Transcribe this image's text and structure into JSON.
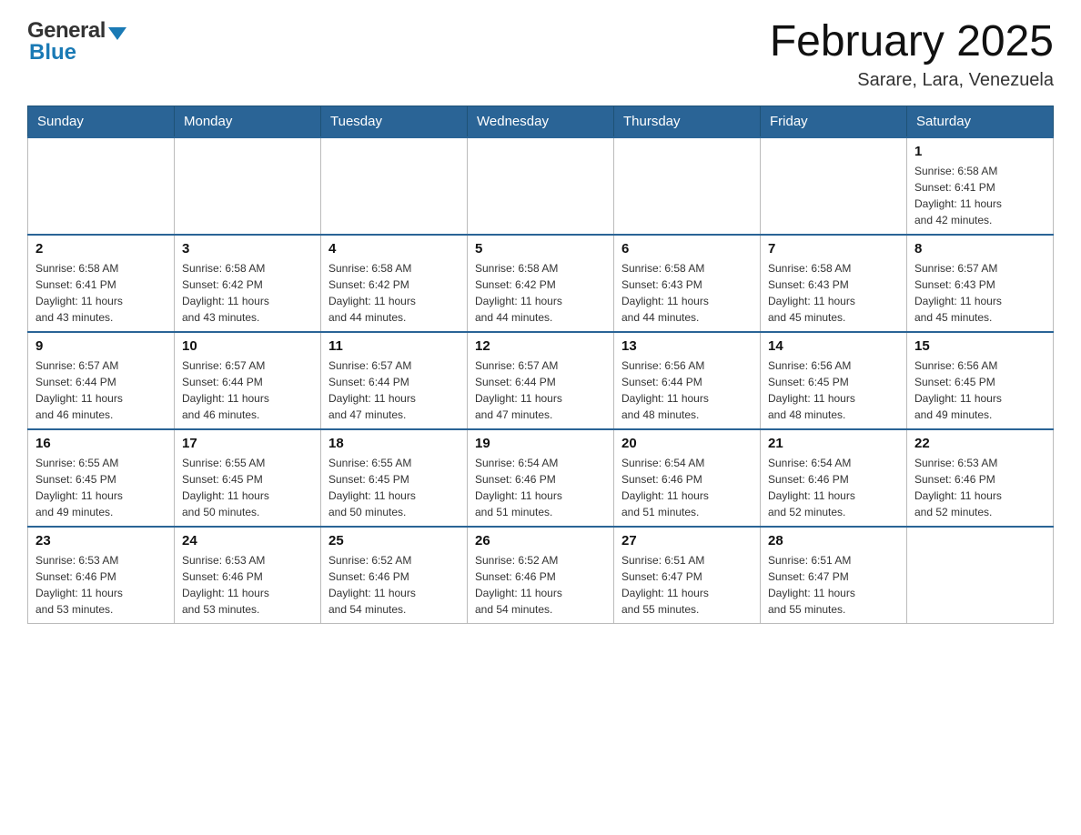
{
  "header": {
    "logo": {
      "general": "General",
      "blue": "Blue"
    },
    "title": "February 2025",
    "location": "Sarare, Lara, Venezuela"
  },
  "calendar": {
    "days_of_week": [
      "Sunday",
      "Monday",
      "Tuesday",
      "Wednesday",
      "Thursday",
      "Friday",
      "Saturday"
    ],
    "weeks": [
      [
        {
          "day": "",
          "info": ""
        },
        {
          "day": "",
          "info": ""
        },
        {
          "day": "",
          "info": ""
        },
        {
          "day": "",
          "info": ""
        },
        {
          "day": "",
          "info": ""
        },
        {
          "day": "",
          "info": ""
        },
        {
          "day": "1",
          "info": "Sunrise: 6:58 AM\nSunset: 6:41 PM\nDaylight: 11 hours\nand 42 minutes."
        }
      ],
      [
        {
          "day": "2",
          "info": "Sunrise: 6:58 AM\nSunset: 6:41 PM\nDaylight: 11 hours\nand 43 minutes."
        },
        {
          "day": "3",
          "info": "Sunrise: 6:58 AM\nSunset: 6:42 PM\nDaylight: 11 hours\nand 43 minutes."
        },
        {
          "day": "4",
          "info": "Sunrise: 6:58 AM\nSunset: 6:42 PM\nDaylight: 11 hours\nand 44 minutes."
        },
        {
          "day": "5",
          "info": "Sunrise: 6:58 AM\nSunset: 6:42 PM\nDaylight: 11 hours\nand 44 minutes."
        },
        {
          "day": "6",
          "info": "Sunrise: 6:58 AM\nSunset: 6:43 PM\nDaylight: 11 hours\nand 44 minutes."
        },
        {
          "day": "7",
          "info": "Sunrise: 6:58 AM\nSunset: 6:43 PM\nDaylight: 11 hours\nand 45 minutes."
        },
        {
          "day": "8",
          "info": "Sunrise: 6:57 AM\nSunset: 6:43 PM\nDaylight: 11 hours\nand 45 minutes."
        }
      ],
      [
        {
          "day": "9",
          "info": "Sunrise: 6:57 AM\nSunset: 6:44 PM\nDaylight: 11 hours\nand 46 minutes."
        },
        {
          "day": "10",
          "info": "Sunrise: 6:57 AM\nSunset: 6:44 PM\nDaylight: 11 hours\nand 46 minutes."
        },
        {
          "day": "11",
          "info": "Sunrise: 6:57 AM\nSunset: 6:44 PM\nDaylight: 11 hours\nand 47 minutes."
        },
        {
          "day": "12",
          "info": "Sunrise: 6:57 AM\nSunset: 6:44 PM\nDaylight: 11 hours\nand 47 minutes."
        },
        {
          "day": "13",
          "info": "Sunrise: 6:56 AM\nSunset: 6:44 PM\nDaylight: 11 hours\nand 48 minutes."
        },
        {
          "day": "14",
          "info": "Sunrise: 6:56 AM\nSunset: 6:45 PM\nDaylight: 11 hours\nand 48 minutes."
        },
        {
          "day": "15",
          "info": "Sunrise: 6:56 AM\nSunset: 6:45 PM\nDaylight: 11 hours\nand 49 minutes."
        }
      ],
      [
        {
          "day": "16",
          "info": "Sunrise: 6:55 AM\nSunset: 6:45 PM\nDaylight: 11 hours\nand 49 minutes."
        },
        {
          "day": "17",
          "info": "Sunrise: 6:55 AM\nSunset: 6:45 PM\nDaylight: 11 hours\nand 50 minutes."
        },
        {
          "day": "18",
          "info": "Sunrise: 6:55 AM\nSunset: 6:45 PM\nDaylight: 11 hours\nand 50 minutes."
        },
        {
          "day": "19",
          "info": "Sunrise: 6:54 AM\nSunset: 6:46 PM\nDaylight: 11 hours\nand 51 minutes."
        },
        {
          "day": "20",
          "info": "Sunrise: 6:54 AM\nSunset: 6:46 PM\nDaylight: 11 hours\nand 51 minutes."
        },
        {
          "day": "21",
          "info": "Sunrise: 6:54 AM\nSunset: 6:46 PM\nDaylight: 11 hours\nand 52 minutes."
        },
        {
          "day": "22",
          "info": "Sunrise: 6:53 AM\nSunset: 6:46 PM\nDaylight: 11 hours\nand 52 minutes."
        }
      ],
      [
        {
          "day": "23",
          "info": "Sunrise: 6:53 AM\nSunset: 6:46 PM\nDaylight: 11 hours\nand 53 minutes."
        },
        {
          "day": "24",
          "info": "Sunrise: 6:53 AM\nSunset: 6:46 PM\nDaylight: 11 hours\nand 53 minutes."
        },
        {
          "day": "25",
          "info": "Sunrise: 6:52 AM\nSunset: 6:46 PM\nDaylight: 11 hours\nand 54 minutes."
        },
        {
          "day": "26",
          "info": "Sunrise: 6:52 AM\nSunset: 6:46 PM\nDaylight: 11 hours\nand 54 minutes."
        },
        {
          "day": "27",
          "info": "Sunrise: 6:51 AM\nSunset: 6:47 PM\nDaylight: 11 hours\nand 55 minutes."
        },
        {
          "day": "28",
          "info": "Sunrise: 6:51 AM\nSunset: 6:47 PM\nDaylight: 11 hours\nand 55 minutes."
        },
        {
          "day": "",
          "info": ""
        }
      ]
    ]
  }
}
